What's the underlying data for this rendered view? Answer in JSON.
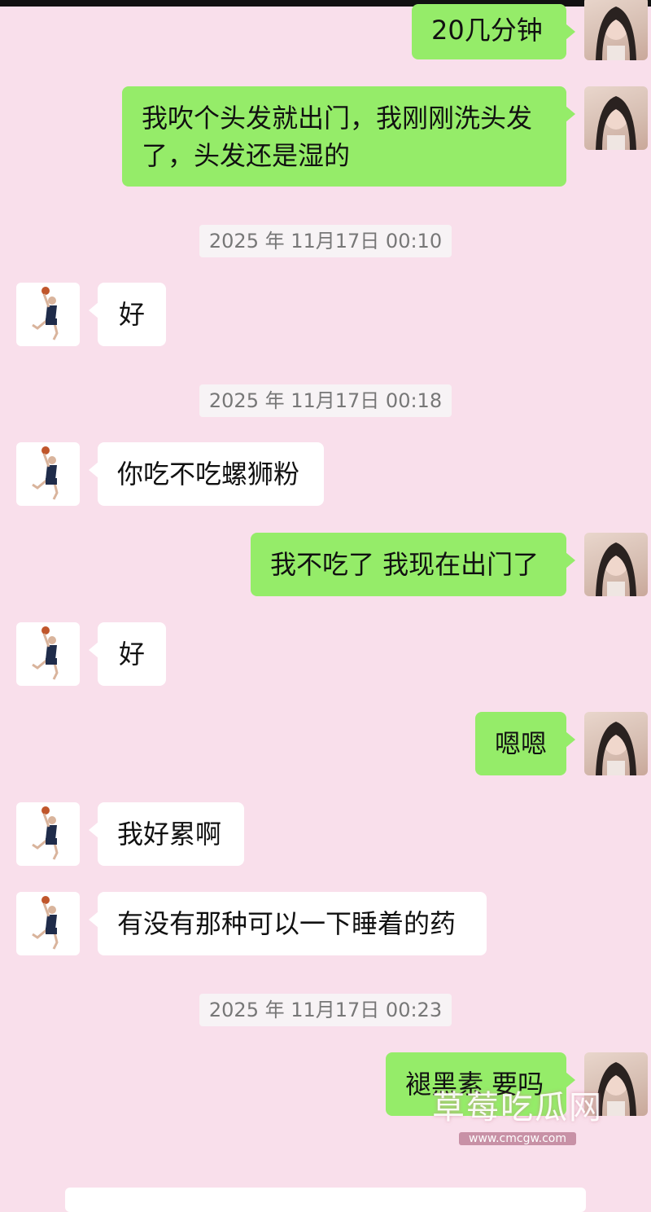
{
  "messages": [
    {
      "type": "sent",
      "text": "20几分钟"
    },
    {
      "type": "sent",
      "text": "我吹个头发就出门，我刚刚洗头发了，头发还是湿的"
    },
    {
      "type": "time",
      "text": "2025 年 11月17日 00:10"
    },
    {
      "type": "received",
      "text": "好"
    },
    {
      "type": "time",
      "text": "2025 年 11月17日 00:18"
    },
    {
      "type": "received",
      "text": "你吃不吃螺狮粉"
    },
    {
      "type": "sent",
      "text": "我不吃了 我现在出门了"
    },
    {
      "type": "received",
      "text": "好"
    },
    {
      "type": "sent",
      "text": "嗯嗯"
    },
    {
      "type": "received",
      "text": "我好累啊"
    },
    {
      "type": "received",
      "text": "有没有那种可以一下睡着的药"
    },
    {
      "type": "time",
      "text": "2025 年 11月17日 00:23"
    },
    {
      "type": "sent",
      "text": "褪黑素 要吗"
    }
  ],
  "watermark": {
    "title": "草莓吃瓜网",
    "url": "www.cmcgw.com"
  },
  "avatars": {
    "self": "female-portrait-avatar",
    "other": "basketball-player-avatar"
  },
  "colors": {
    "background": "#f9dfeb",
    "sent_bubble": "#95ec69",
    "received_bubble": "#ffffff"
  }
}
